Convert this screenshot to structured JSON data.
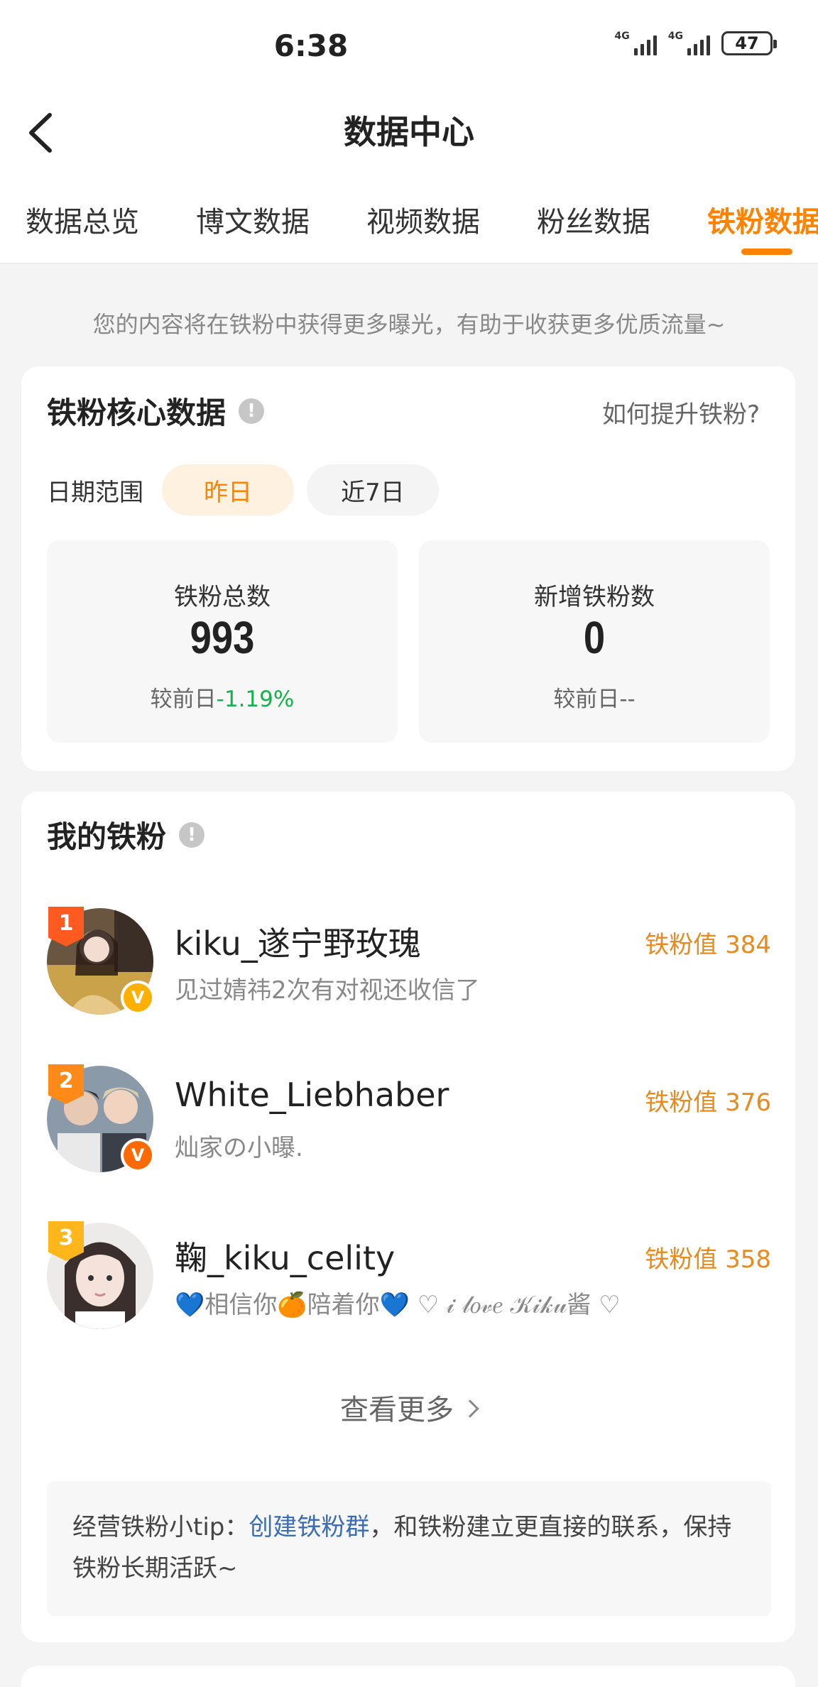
{
  "status_bar": {
    "time": "6:38",
    "signal1": "4G",
    "signal2": "4G",
    "battery": "47"
  },
  "header": {
    "title": "数据中心"
  },
  "tabs": [
    {
      "label": "数据总览"
    },
    {
      "label": "博文数据"
    },
    {
      "label": "视频数据"
    },
    {
      "label": "粉丝数据"
    },
    {
      "label": "铁粉数据"
    }
  ],
  "intro": "您的内容将在铁粉中获得更多曝光，有助于收获更多优质流量~",
  "core": {
    "title": "铁粉核心数据",
    "help_link": "如何提升铁粉?",
    "date_label": "日期范围",
    "date_options": [
      "昨日",
      "近7日"
    ],
    "stats": [
      {
        "label": "铁粉总数",
        "value": "993",
        "compare_prefix": "较前日",
        "compare_value": "-1.19%"
      },
      {
        "label": "新增铁粉数",
        "value": "0",
        "compare_prefix": "较前日",
        "compare_value": "--"
      }
    ]
  },
  "my_fans": {
    "title": "我的铁粉",
    "fans": [
      {
        "rank": "1",
        "name": "kiku_遂宁野玫瑰",
        "desc": "见过婧祎2次有对视还收信了",
        "score": "铁粉值 384"
      },
      {
        "rank": "2",
        "name": "White_Liebhaber",
        "desc": "灿家の小曝.",
        "score": "铁粉值 376"
      },
      {
        "rank": "3",
        "name": "鞠_kiku_celity",
        "desc": "💙相信你🍊陪着你💙 ♡ 𝒾 𝓁𝑜𝓋𝑒 𝒦𝒾𝓀𝓊酱 ♡",
        "score": "铁粉值 358"
      }
    ],
    "more_label": "查看更多",
    "tip_prefix": "经营铁粉小tip：",
    "tip_link": "创建铁粉群",
    "tip_rest": "，和铁粉建立更直接的联系，保持铁粉长期活跃~"
  },
  "colors": {
    "accent": "#ff8200",
    "positive": "#14b14c",
    "link": "#3a6db3"
  }
}
